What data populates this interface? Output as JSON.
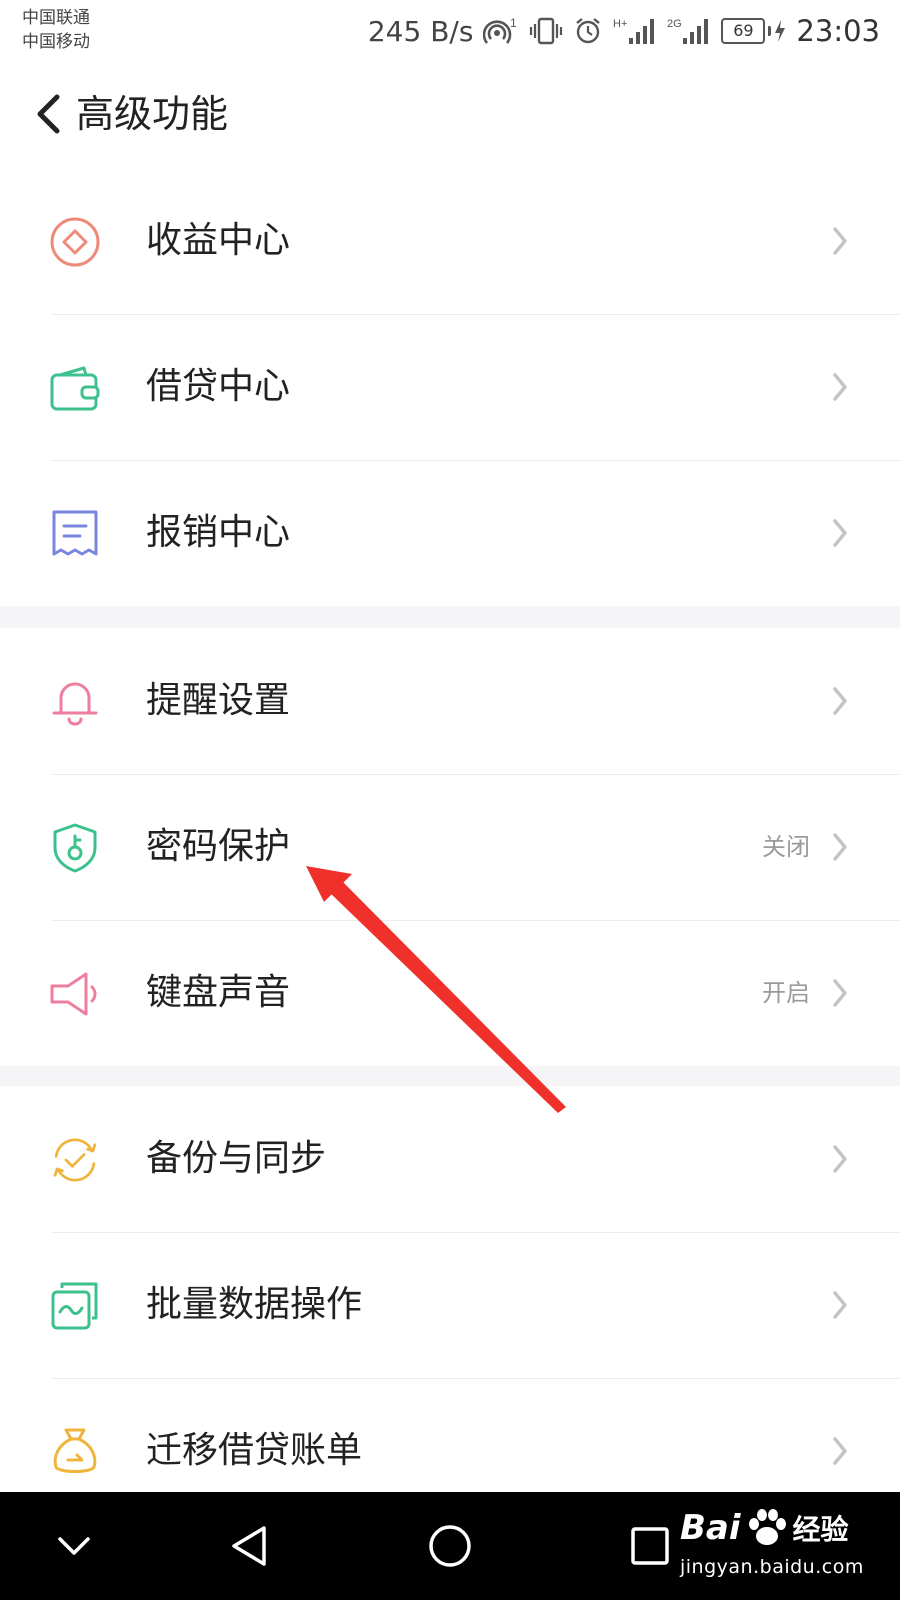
{
  "status_bar": {
    "carrier_1": "中国联通",
    "carrier_2": "中国移动",
    "net_speed": "245 B/s",
    "hotspot_badge": "1",
    "network_1": "H+",
    "network_2": "2G",
    "battery": "69",
    "time": "23:03"
  },
  "header": {
    "title": "高级功能"
  },
  "groups": [
    {
      "items": [
        {
          "label": "收益中心",
          "value": "",
          "icon": "diamond-circle-icon",
          "color": "#ee8a7a"
        },
        {
          "label": "借贷中心",
          "value": "",
          "icon": "wallet-icon",
          "color": "#3cc08c"
        },
        {
          "label": "报销中心",
          "value": "",
          "icon": "receipt-icon",
          "color": "#7a86de"
        }
      ]
    },
    {
      "items": [
        {
          "label": "提醒设置",
          "value": "",
          "icon": "bell-icon",
          "color": "#ee7e9e"
        },
        {
          "label": "密码保护",
          "value": "关闭",
          "icon": "shield-key-icon",
          "color": "#3cc08c"
        },
        {
          "label": "键盘声音",
          "value": "开启",
          "icon": "speaker-icon",
          "color": "#ee7e9e"
        }
      ]
    },
    {
      "items": [
        {
          "label": "备份与同步",
          "value": "",
          "icon": "sync-check-icon",
          "color": "#f0b43c"
        },
        {
          "label": "批量数据操作",
          "value": "",
          "icon": "batch-data-icon",
          "color": "#3cc08c"
        },
        {
          "label": "迁移借贷账单",
          "value": "",
          "icon": "money-bag-icon",
          "color": "#f0b43c"
        }
      ]
    }
  ],
  "annotation": {
    "color": "#f0302a"
  },
  "nav_bar": {
    "watermark_brand": "Bai",
    "watermark_suffix": "经验",
    "watermark_url": "jingyan.baidu.com"
  }
}
